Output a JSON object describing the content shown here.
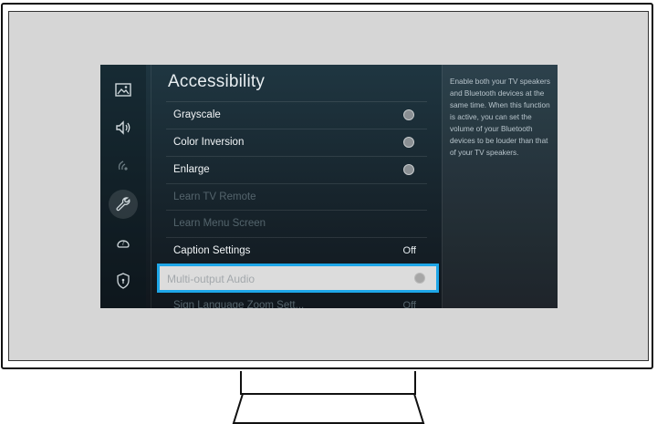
{
  "screen": {
    "title": "Accessibility",
    "menu": [
      {
        "label": "Grayscale",
        "state": "off-toggle",
        "enabled": true
      },
      {
        "label": "Color Inversion",
        "state": "off-toggle",
        "enabled": true
      },
      {
        "label": "Enlarge",
        "state": "off-toggle",
        "enabled": true
      },
      {
        "label": "Learn TV Remote",
        "enabled": false
      },
      {
        "label": "Learn Menu Screen",
        "enabled": false
      },
      {
        "label": "Caption Settings",
        "value": "Off",
        "enabled": true
      },
      {
        "label": "Multi-output Audio",
        "state": "off-toggle",
        "enabled": false,
        "focused": true
      },
      {
        "label": "Sign Language Zoom Sett...",
        "value": "Off",
        "enabled": false
      }
    ],
    "description": "Enable both your TV speakers and Bluetooth devices at the same time. When this function is active, you can set the volume of your Bluetooth devices to be louder than that of your TV speakers.",
    "sidebar_icons": [
      "picture-icon",
      "sound-icon",
      "connection-icon",
      "wrench-icon",
      "support-icon",
      "privacy-shield-icon"
    ],
    "selected_icon": "wrench-icon"
  },
  "colors": {
    "focus_border": "#1ea6e8",
    "screen_bg": "#1f3641"
  }
}
